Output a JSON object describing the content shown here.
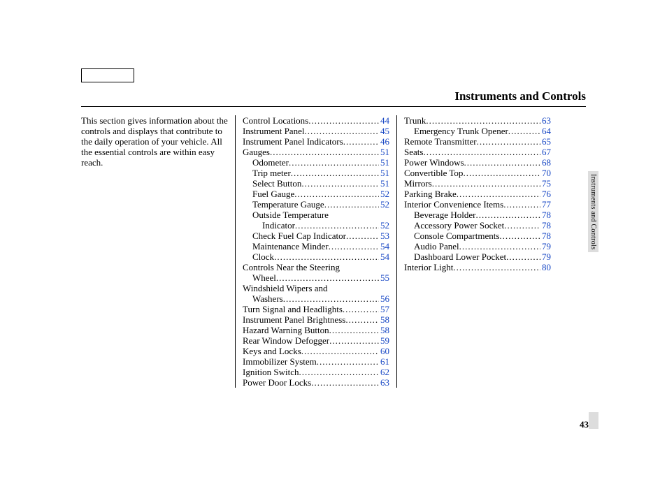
{
  "header": {
    "title": "Instruments and Controls"
  },
  "side_tab": "Instruments and Controls",
  "page_number": "43",
  "intro": "This section gives information about the controls and displays that contribute to the daily operation of your vehicle. All the essential controls are within easy reach.",
  "col2": [
    {
      "label": "Control Locations",
      "page": "44",
      "indent": 0
    },
    {
      "label": "Instrument Panel",
      "page": "45",
      "indent": 0
    },
    {
      "label": "Instrument Panel Indicators",
      "page": "46",
      "indent": 0
    },
    {
      "label": "Gauges",
      "page": "51",
      "indent": 0
    },
    {
      "label": "Odometer",
      "page": "51",
      "indent": 1
    },
    {
      "label": "Trip meter",
      "page": "51",
      "indent": 1
    },
    {
      "label": "Select Button",
      "page": "51",
      "indent": 1
    },
    {
      "label": "Fuel Gauge",
      "page": "52",
      "indent": 1
    },
    {
      "label": "Temperature Gauge",
      "page": "52",
      "indent": 1
    },
    {
      "wraptext": "Outside Temperature",
      "label": "Indicator",
      "page": "52",
      "indent": 2
    },
    {
      "label": "Check Fuel Cap Indicator",
      "page": "53",
      "indent": 1
    },
    {
      "label": "Maintenance Minder",
      "page": "54",
      "indent": 1
    },
    {
      "label": "Clock",
      "page": "54",
      "indent": 1
    },
    {
      "wraptext": "Controls Near the Steering",
      "label": "Wheel",
      "page": "55",
      "indent": 0,
      "wrapindent": 1
    },
    {
      "wraptext": "Windshield Wipers and",
      "label": "Washers",
      "page": "56",
      "indent": 0,
      "wrapindent": 1
    },
    {
      "label": "Turn Signal and Headlights",
      "page": "57",
      "indent": 0
    },
    {
      "label": "Instrument Panel Brightness",
      "page": "58",
      "indent": 0
    },
    {
      "label": "Hazard Warning Button",
      "page": "58",
      "indent": 0
    },
    {
      "label": "Rear Window Defogger",
      "page": "59",
      "indent": 0
    },
    {
      "label": "Keys and Locks",
      "page": "60",
      "indent": 0
    },
    {
      "label": "Immobilizer System",
      "page": "61",
      "indent": 0
    },
    {
      "label": "Ignition Switch",
      "page": "62",
      "indent": 0
    },
    {
      "label": "Power Door Locks",
      "page": "63",
      "indent": 0
    }
  ],
  "col3": [
    {
      "label": "Trunk",
      "page": "63",
      "indent": 0
    },
    {
      "label": "Emergency Trunk Opener",
      "page": "64",
      "indent": 1
    },
    {
      "label": "Remote Transmitter",
      "page": "65",
      "indent": 0
    },
    {
      "label": "Seats",
      "page": "67",
      "indent": 0
    },
    {
      "label": "Power Windows",
      "page": "68",
      "indent": 0
    },
    {
      "label": "Convertible Top",
      "page": "70",
      "indent": 0
    },
    {
      "label": "Mirrors",
      "page": "75",
      "indent": 0
    },
    {
      "label": "Parking Brake",
      "page": "76",
      "indent": 0
    },
    {
      "label": "Interior Convenience Items",
      "page": "77",
      "indent": 0
    },
    {
      "label": "Beverage Holder",
      "page": "78",
      "indent": 1
    },
    {
      "label": "Accessory Power Socket",
      "page": "78",
      "indent": 1
    },
    {
      "label": "Console Compartments",
      "page": "78",
      "indent": 1
    },
    {
      "label": "Audio Panel",
      "page": "79",
      "indent": 1
    },
    {
      "label": "Dashboard Lower Pocket",
      "page": "79",
      "indent": 1
    },
    {
      "label": "Interior Light",
      "page": "80",
      "indent": 0
    }
  ]
}
